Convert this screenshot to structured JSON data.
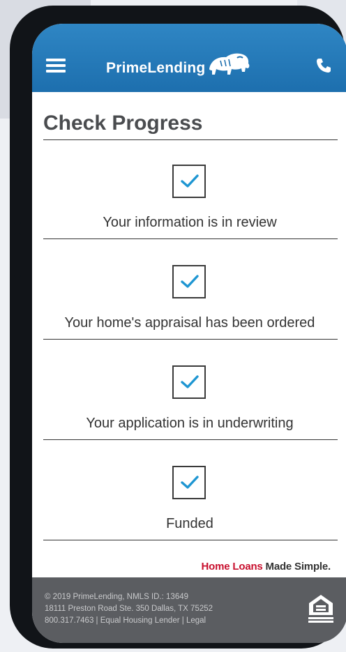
{
  "header": {
    "brand": "PrimeLending",
    "menu_icon": "hamburger-menu-icon",
    "call_icon": "phone-icon",
    "logo_icon": "bison-icon",
    "color": "#1d6fae"
  },
  "page": {
    "title": "Check Progress"
  },
  "steps": [
    {
      "label": "Your information is in review",
      "checked": true
    },
    {
      "label": "Your home's appraisal has been ordered",
      "checked": true
    },
    {
      "label": "Your application is in underwriting",
      "checked": true
    },
    {
      "label": "Funded",
      "checked": true
    }
  ],
  "tagline": {
    "part1": "Home Loans",
    "part2": " Made Simple."
  },
  "footer": {
    "line1": "© 2019 PrimeLending, NMLS ID.: 13649",
    "line2": "18111 Preston Road Ste. 350 Dallas, TX 75252",
    "phone": "800.317.7463",
    "separator": " | ",
    "link_equal_housing": "Equal Housing Lender",
    "link_legal": "Legal",
    "ehl_icon": "equal-housing-lender-icon"
  },
  "colors": {
    "check": "#1e96d2",
    "accent_red": "#c8102e",
    "footer_bg": "#5b5d61"
  }
}
